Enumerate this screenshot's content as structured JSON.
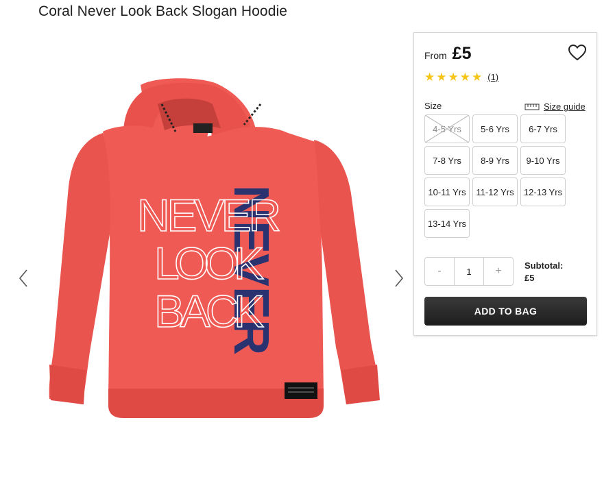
{
  "product": {
    "title": "Coral Never Look Back Slogan Hoodie",
    "price_prefix": "From",
    "price": "£5",
    "rating_stars": 5,
    "review_count": "(1)",
    "print": {
      "lines": [
        "NEVER",
        "LOOK",
        "BACK"
      ],
      "vertical": "NEVER"
    },
    "colors": {
      "hoodie": "#ef5a55",
      "print_navy": "#2a3370",
      "accent": "#f5c518"
    }
  },
  "size": {
    "label": "Size",
    "guide_label": "Size guide",
    "options": [
      {
        "label": "4-5 Yrs",
        "available": false
      },
      {
        "label": "5-6 Yrs",
        "available": true
      },
      {
        "label": "6-7 Yrs",
        "available": true
      },
      {
        "label": "7-8 Yrs",
        "available": true
      },
      {
        "label": "8-9 Yrs",
        "available": true
      },
      {
        "label": "9-10 Yrs",
        "available": true
      },
      {
        "label": "10-11 Yrs",
        "available": true
      },
      {
        "label": "11-12 Yrs",
        "available": true
      },
      {
        "label": "12-13 Yrs",
        "available": true
      },
      {
        "label": "13-14 Yrs",
        "available": true
      }
    ]
  },
  "quantity": {
    "decrement": "-",
    "value": "1",
    "increment": "+"
  },
  "subtotal": {
    "label": "Subtotal:",
    "value": "£5"
  },
  "cta": {
    "add_to_bag": "ADD TO BAG"
  },
  "icons": {
    "prev": "chevron-left-icon",
    "next": "chevron-right-icon",
    "wishlist": "heart-icon",
    "size_guide": "ruler-icon"
  }
}
